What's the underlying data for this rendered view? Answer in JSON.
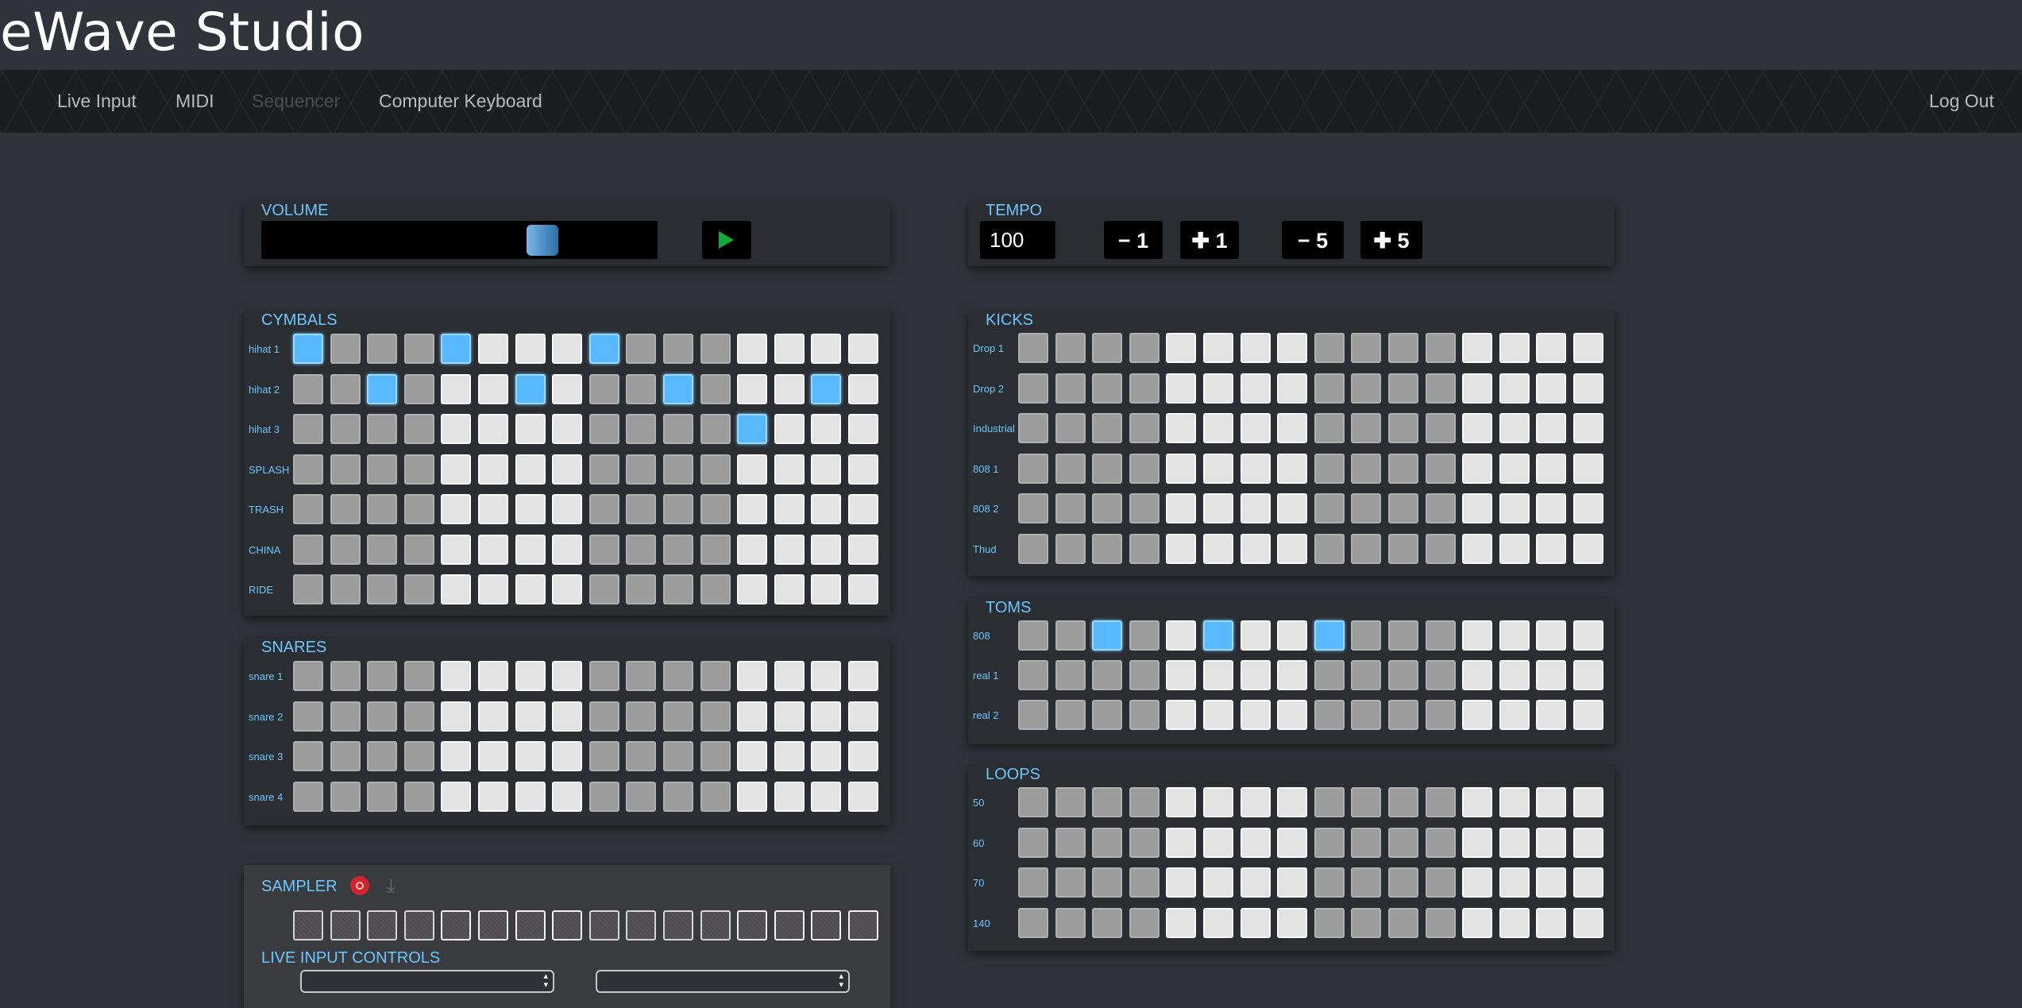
{
  "app": {
    "title": "eWave Studio"
  },
  "nav": {
    "links": [
      "Live Input",
      "MIDI",
      "Sequencer",
      "Computer Keyboard"
    ],
    "active": "Sequencer",
    "logout": "Log Out"
  },
  "volume": {
    "label": "VOLUME",
    "level": 0.73,
    "play_icon": "play-icon"
  },
  "tempo": {
    "label": "TEMPO",
    "value": "100",
    "buttons": [
      {
        "label": "− 1",
        "name": "tempo-minus-1-button"
      },
      {
        "label": "✚ 1",
        "name": "tempo-plus-1-button"
      },
      {
        "label": "− 5",
        "name": "tempo-minus-5-button"
      },
      {
        "label": "✚ 5",
        "name": "tempo-plus-5-button"
      }
    ]
  },
  "steps_per_row": 16,
  "sections": [
    {
      "id": "cymbals",
      "title": "CYMBALS",
      "rows": [
        {
          "label": "hihat 1",
          "active": [
            0,
            4,
            8
          ]
        },
        {
          "label": "hihat 2",
          "active": [
            2,
            6,
            10,
            14
          ]
        },
        {
          "label": "hihat 3",
          "active": [
            12
          ]
        },
        {
          "label": "SPLASH",
          "active": []
        },
        {
          "label": "TRASH",
          "active": []
        },
        {
          "label": "CHINA",
          "active": []
        },
        {
          "label": "RIDE",
          "active": []
        }
      ]
    },
    {
      "id": "snares",
      "title": "SNARES",
      "rows": [
        {
          "label": "snare 1",
          "active": []
        },
        {
          "label": "snare 2",
          "active": []
        },
        {
          "label": "snare 3",
          "active": []
        },
        {
          "label": "snare 4",
          "active": []
        }
      ]
    },
    {
      "id": "kicks",
      "title": "KICKS",
      "rows": [
        {
          "label": "Drop 1",
          "active": []
        },
        {
          "label": "Drop 2",
          "active": []
        },
        {
          "label": "Industrial",
          "active": []
        },
        {
          "label": "808 1",
          "active": []
        },
        {
          "label": "808 2",
          "active": []
        },
        {
          "label": "Thud",
          "active": []
        }
      ]
    },
    {
      "id": "toms",
      "title": "TOMS",
      "rows": [
        {
          "label": "808",
          "active": [
            2,
            5,
            8
          ]
        },
        {
          "label": "real 1",
          "active": []
        },
        {
          "label": "real 2",
          "active": []
        }
      ]
    },
    {
      "id": "loops",
      "title": "LOOPS",
      "rows": [
        {
          "label": "50",
          "active": []
        },
        {
          "label": "60",
          "active": []
        },
        {
          "label": "70",
          "active": []
        },
        {
          "label": "140",
          "active": []
        }
      ]
    }
  ],
  "sampler": {
    "label": "SAMPLER",
    "record_icon": "record-icon",
    "download_icon": "download-icon",
    "live_input_label": "LIVE INPUT CONTROLS",
    "select_1": "",
    "select_2": ""
  }
}
